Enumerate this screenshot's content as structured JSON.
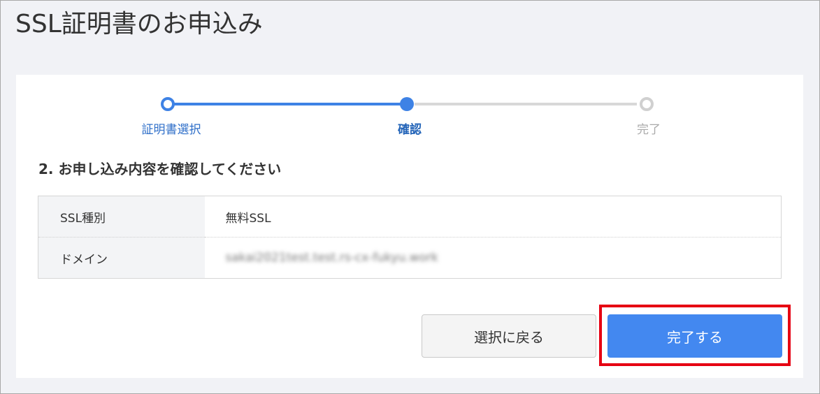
{
  "page": {
    "title": "SSL証明書のお申込み"
  },
  "stepper": {
    "steps": [
      {
        "label": "証明書選択",
        "state": "done"
      },
      {
        "label": "確認",
        "state": "current"
      },
      {
        "label": "完了",
        "state": "todo"
      }
    ]
  },
  "section": {
    "heading": "2. お申し込み内容を確認してください"
  },
  "details": {
    "rows": [
      {
        "label": "SSL種別",
        "value": "無料SSL"
      },
      {
        "label": "ドメイン",
        "value": "sakai2021test.test.rs-cx-fukyu.work"
      }
    ]
  },
  "actions": {
    "back_label": "選択に戻る",
    "complete_label": "完了する"
  },
  "colors": {
    "accent": "#4388f0",
    "step_active": "#3e82e5",
    "highlight": "#e60012"
  }
}
